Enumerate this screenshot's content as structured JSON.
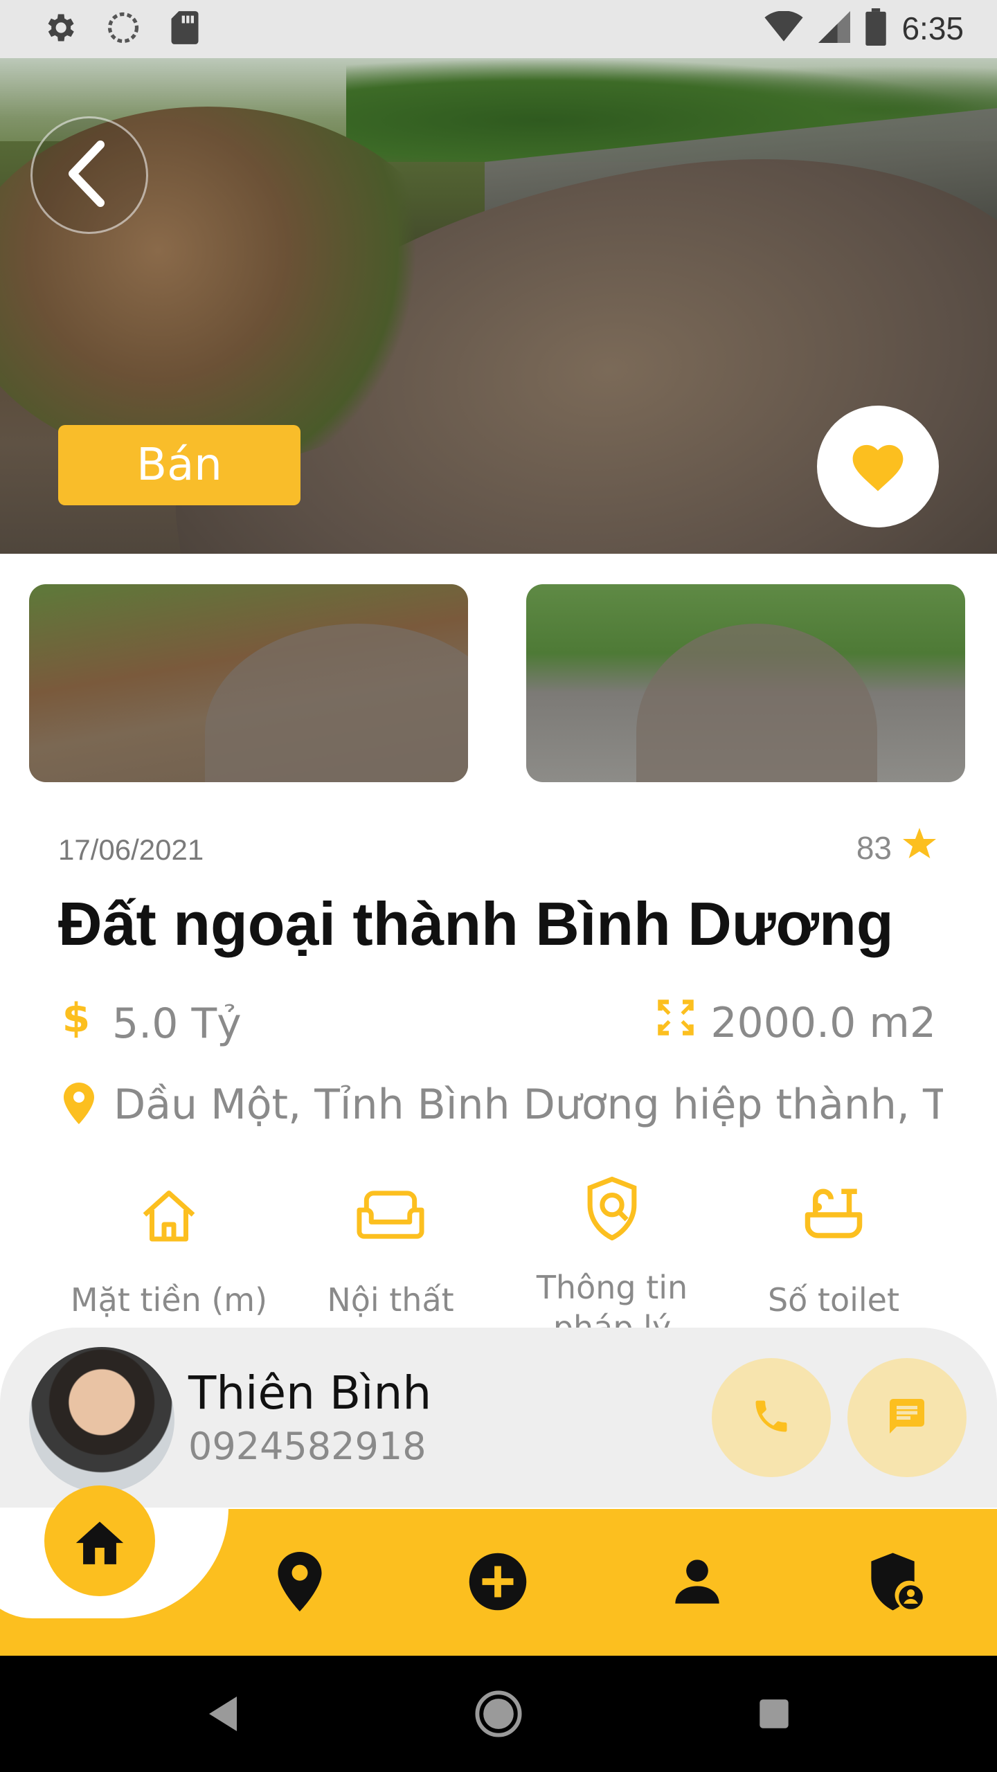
{
  "status_bar": {
    "time": "6:35",
    "icons": [
      "settings-icon",
      "sync-icon",
      "sd-card-icon",
      "wifi-icon",
      "signal-icon",
      "battery-icon"
    ]
  },
  "hero": {
    "badge_label": "Bán",
    "back_icon": "chevron-left-icon",
    "favorite_icon": "heart-icon"
  },
  "listing": {
    "date": "17/06/2021",
    "views": "83",
    "title": "Đất ngoại thành Bình Dương",
    "price": "5.0 Tỷ",
    "area": "2000.0 m2",
    "address": "Dầu Một, Tỉnh Bình Dương   hiệp thành, T"
  },
  "features": [
    {
      "label": "Mặt tiền (m)",
      "icon": "house-icon"
    },
    {
      "label": "Nội thất",
      "icon": "sofa-icon"
    },
    {
      "label": "Thông tin pháp lý",
      "icon": "shield-icon"
    },
    {
      "label": "Số toilet",
      "icon": "bathtub-icon"
    }
  ],
  "contact": {
    "name": "Thiên Bình",
    "phone": "0924582918"
  },
  "bottom_nav": {
    "items": [
      "home-icon",
      "map-pin-icon",
      "add-icon",
      "profile-icon",
      "admin-shield-icon"
    ]
  },
  "colors": {
    "accent": "#fcbf1f",
    "accent_light": "#f7e4ae",
    "text_muted": "#8a8a8a",
    "text_dark": "#111111"
  }
}
